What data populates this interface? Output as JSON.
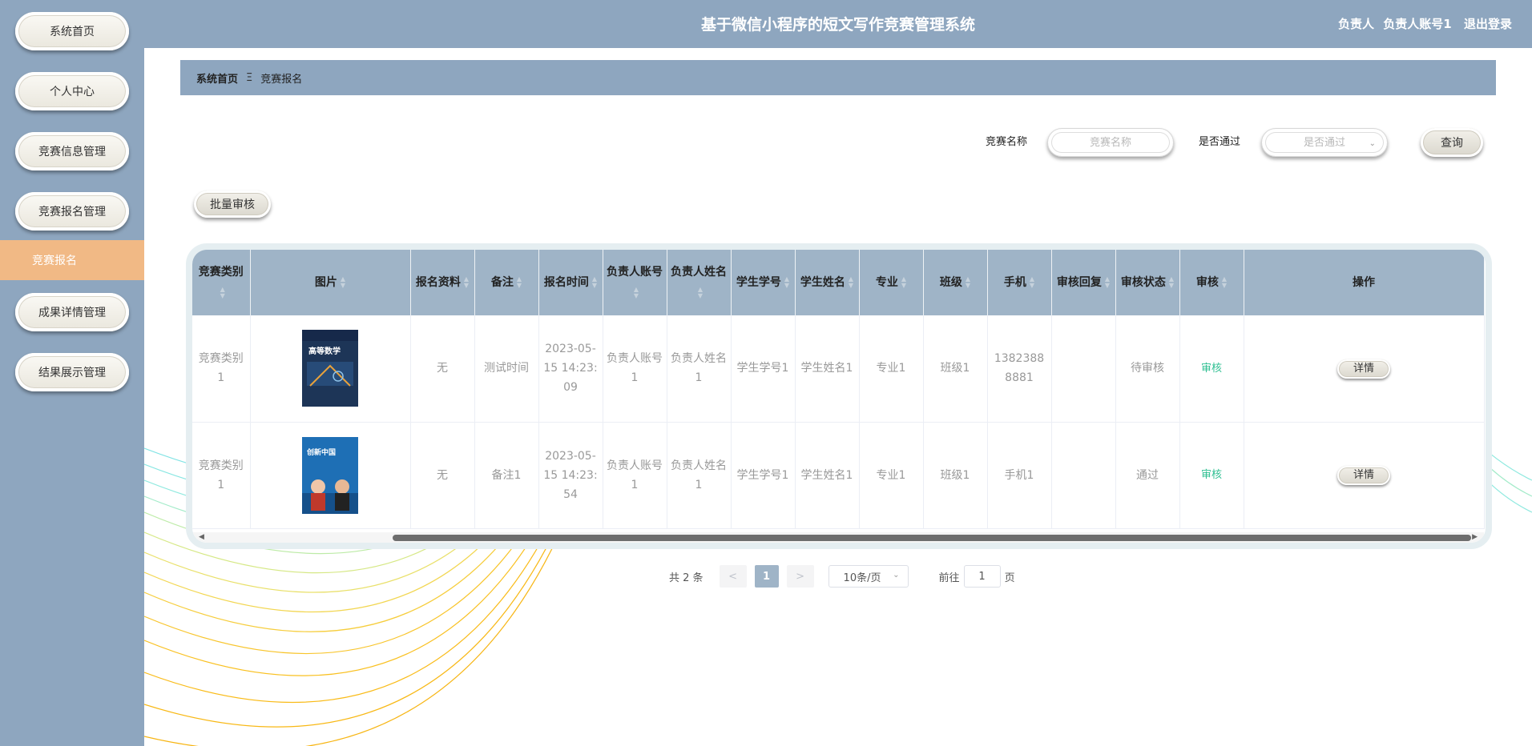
{
  "header": {
    "title": "基于微信小程序的短文写作竞赛管理系统",
    "role": "负责人",
    "account": "负责人账号1",
    "logout": "退出登录"
  },
  "sidebar": {
    "items": [
      {
        "label": "系统首页"
      },
      {
        "label": "个人中心"
      },
      {
        "label": "竞赛信息管理"
      },
      {
        "label": "竞赛报名管理"
      },
      {
        "label": "成果详情管理"
      },
      {
        "label": "结果展示管理"
      }
    ],
    "active_sub": "竞赛报名"
  },
  "breadcrumb": {
    "home": "系统首页",
    "separator": "Ξ",
    "current": "竞赛报名"
  },
  "search": {
    "name_label": "竞赛名称",
    "name_placeholder": "竞赛名称",
    "pass_label": "是否通过",
    "pass_placeholder": "是否通过",
    "query_button": "查询"
  },
  "batch_button": "批量审核",
  "table": {
    "headers": [
      "竞赛类别",
      "图片",
      "报名资料",
      "备注",
      "报名时间",
      "负责人账号",
      "负责人姓名",
      "学生学号",
      "学生姓名",
      "专业",
      "班级",
      "手机",
      "审核回复",
      "审核状态",
      "审核",
      "操作"
    ],
    "rows": [
      {
        "category": "竞赛类别1",
        "image": "高等数学",
        "material": "无",
        "note": "测试时间",
        "time": "2023-05-15 14:23:09",
        "leader_account": "负责人账号1",
        "leader_name": "负责人姓名1",
        "student_id": "学生学号1",
        "student_name": "学生姓名1",
        "major": "专业1",
        "class": "班级1",
        "phone": "13823888881",
        "reply": "",
        "status": "待审核",
        "audit": "审核",
        "action": "详情"
      },
      {
        "category": "竞赛类别1",
        "image": "创新中国",
        "material": "无",
        "note": "备注1",
        "time": "2023-05-15 14:23:54",
        "leader_account": "负责人账号1",
        "leader_name": "负责人姓名1",
        "student_id": "学生学号1",
        "student_name": "学生姓名1",
        "major": "专业1",
        "class": "班级1",
        "phone": "手机1",
        "reply": "",
        "status": "通过",
        "audit": "审核",
        "action": "详情"
      }
    ]
  },
  "pagination": {
    "total": "共 2 条",
    "prev": "<",
    "current": "1",
    "next": ">",
    "page_size": "10条/页",
    "goto_prefix": "前往",
    "goto_value": "1",
    "goto_suffix": "页"
  },
  "colors": {
    "primary": "#8ea6bf",
    "table_header": "#9fb4c7",
    "active_menu": "#f1b985",
    "audit_link": "#2fbf92"
  }
}
